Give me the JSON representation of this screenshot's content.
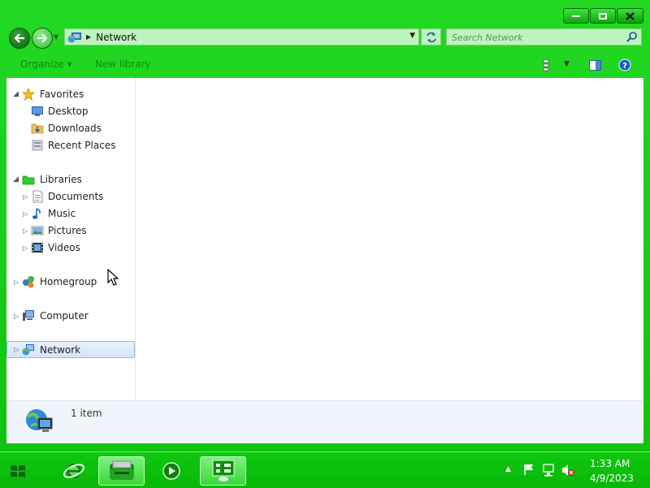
{
  "window": {
    "address_path": "Network",
    "search_placeholder": "Search Network"
  },
  "toolbar": {
    "organize_label": "Organize ▾",
    "new_library_label": "New library"
  },
  "nav_pane": {
    "favorites": {
      "label": "Favorites",
      "items": [
        "Desktop",
        "Downloads",
        "Recent Places"
      ]
    },
    "libraries": {
      "label": "Libraries",
      "items": [
        "Documents",
        "Music",
        "Pictures",
        "Videos"
      ]
    },
    "homegroup": "Homegroup",
    "computer": "Computer",
    "network": "Network"
  },
  "details": {
    "item_count": "1 item"
  },
  "taskbar": {
    "clock_time": "1:33 AM",
    "clock_date": "4/9/2023"
  },
  "colors": {
    "accent": "#14c814",
    "selection": "#d4e5f8"
  }
}
